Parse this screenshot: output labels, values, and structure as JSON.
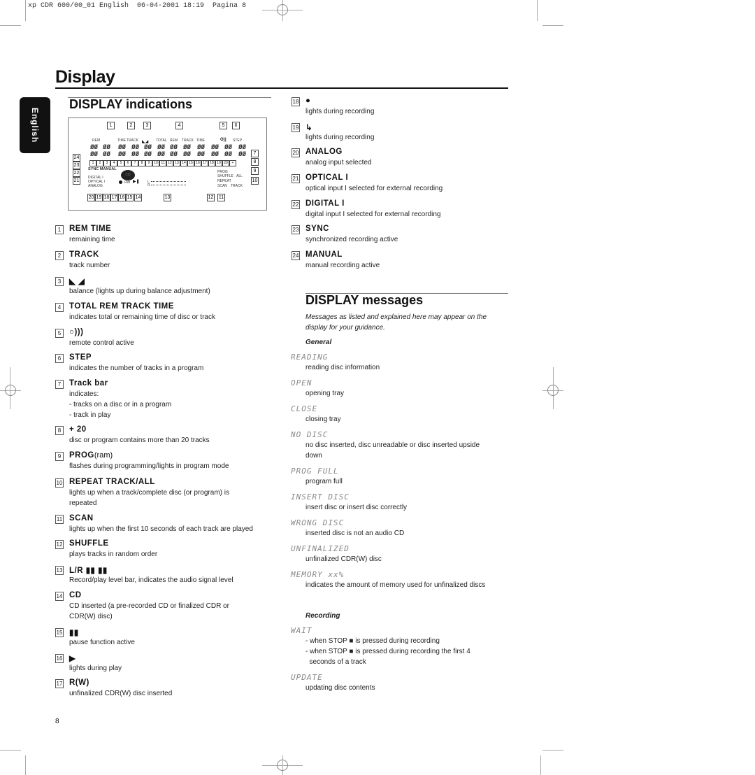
{
  "slug": "xp CDR 600/00_01 English  06-04-2001 18:19  Pagina 8",
  "page_title": "Display",
  "language_tab": "English",
  "indications": {
    "heading": "DISPLAY indications",
    "diagram": {
      "top_labels": [
        "REM",
        "TIME",
        "TRACK",
        "TOTAL",
        "REM",
        "TRACK",
        "TIME",
        "STEP"
      ],
      "left_labels": [
        "SYNC MANUAL",
        "DIGITAL I",
        "OPTICAL I",
        "ANALOG"
      ],
      "right_labels": [
        "PROG",
        "SHUFFLE",
        "ALL",
        "REPEAT",
        "SCAN",
        "TRACK"
      ],
      "level_labels": [
        "L",
        "R"
      ],
      "rw_label": "RW",
      "cd_label": "CD",
      "track_bar": [
        "1",
        "2",
        "3",
        "4",
        "5",
        "6",
        "7",
        "8",
        "9",
        "10",
        "11",
        "12",
        "13",
        "14",
        "15",
        "16",
        "17",
        "18",
        "19",
        "20",
        "+"
      ],
      "callouts_top": [
        "1",
        "2",
        "3",
        "4",
        "5",
        "6"
      ],
      "callouts_right": [
        "7",
        "8",
        "9",
        "10"
      ],
      "callouts_left": [
        "24",
        "23",
        "22",
        "21"
      ],
      "callouts_bottom": [
        "20",
        "19",
        "18",
        "17",
        "16",
        "15",
        "14",
        "13",
        "12",
        "11"
      ]
    },
    "items": [
      {
        "n": "1",
        "title": "REM TIME",
        "desc": [
          "remaining time"
        ]
      },
      {
        "n": "2",
        "title": "TRACK",
        "desc": [
          "track number"
        ]
      },
      {
        "n": "3",
        "title": "◣ ◢",
        "desc": [
          "balance (lights up during balance adjustment)"
        ]
      },
      {
        "n": "4",
        "title": "TOTAL REM TRACK TIME",
        "desc": [
          "indicates total or remaining time of disc or track"
        ]
      },
      {
        "n": "5",
        "title": "○)))",
        "desc": [
          "remote control active"
        ]
      },
      {
        "n": "6",
        "title": "STEP",
        "desc": [
          "indicates the number of tracks in a program"
        ]
      },
      {
        "n": "7",
        "title": "Track bar",
        "desc": [
          "indicates:",
          "- tracks on a disc or in a program",
          "- track in play"
        ]
      },
      {
        "n": "8",
        "title": "+ 20",
        "desc": [
          "disc or program contains more than 20 tracks"
        ]
      },
      {
        "n": "9",
        "title": "PROG",
        "title_suffix": "(ram)",
        "desc": [
          "flashes during programming/lights in program mode"
        ]
      },
      {
        "n": "10",
        "title": "REPEAT TRACK/ALL",
        "desc": [
          "lights up when a track/complete disc (or program) is",
          "repeated"
        ]
      },
      {
        "n": "11",
        "title": "SCAN",
        "desc": [
          "lights up when the first 10 seconds of each track are played"
        ]
      },
      {
        "n": "12",
        "title": "SHUFFLE",
        "desc": [
          "plays tracks in random order"
        ]
      },
      {
        "n": "13",
        "title": "L/R ▮▮ ▮▮",
        "desc": [
          "Record/play level bar, indicates the audio signal level"
        ]
      },
      {
        "n": "14",
        "title": "CD",
        "desc": [
          "CD inserted (a pre-recorded CD or finalized CDR or",
          "CDR(W) disc)"
        ]
      },
      {
        "n": "15",
        "title": "▮▮",
        "desc": [
          "pause function active"
        ]
      },
      {
        "n": "16",
        "title": "▶",
        "desc": [
          "lights during play"
        ]
      },
      {
        "n": "17",
        "title": "R(W)",
        "desc": [
          "unfinalized CDR(W) disc inserted"
        ]
      },
      {
        "n": "18",
        "title": "●",
        "desc": [
          "lights during recording"
        ]
      },
      {
        "n": "19",
        "title": "↳",
        "desc": [
          "lights during recording"
        ]
      },
      {
        "n": "20",
        "title": "ANALOG",
        "desc": [
          "analog input selected"
        ]
      },
      {
        "n": "21",
        "title": "OPTICAL I",
        "desc": [
          "optical input I selected for external recording"
        ]
      },
      {
        "n": "22",
        "title": "DIGITAL I",
        "desc": [
          "digital input I selected for external recording"
        ]
      },
      {
        "n": "23",
        "title": "SYNC",
        "desc": [
          "synchronized recording active"
        ]
      },
      {
        "n": "24",
        "title": "MANUAL",
        "desc": [
          "manual recording active"
        ]
      }
    ]
  },
  "messages": {
    "heading": "DISPLAY messages",
    "intro": [
      "Messages as listed and explained here may appear on the",
      "display for your guidance."
    ],
    "general_heading": "General",
    "general": [
      {
        "code": "READING",
        "desc": [
          "reading disc information"
        ]
      },
      {
        "code": "OPEN",
        "desc": [
          "opening tray"
        ]
      },
      {
        "code": "CLOSE",
        "desc": [
          "closing tray"
        ]
      },
      {
        "code": "NO DISC",
        "desc": [
          "no disc inserted, disc unreadable or disc inserted upside",
          "down"
        ]
      },
      {
        "code": "PROG FULL",
        "desc": [
          "program full"
        ]
      },
      {
        "code": "INSERT DISC",
        "desc": [
          "insert disc or insert disc correctly"
        ]
      },
      {
        "code": "WRONG DISC",
        "desc": [
          "inserted disc is not an audio CD"
        ]
      },
      {
        "code": "UNFINALIZED",
        "desc": [
          "unfinalized CDR(W) disc"
        ]
      },
      {
        "code": "MEMORY xx%",
        "desc": [
          "indicates the amount of memory used for unfinalized discs"
        ]
      }
    ],
    "recording_heading": "Recording",
    "recording": [
      {
        "code": "WAIT",
        "desc": [
          "- when STOP ■ is pressed during recording",
          "- when STOP ■ is pressed during recording the first 4",
          "  seconds of a track"
        ]
      },
      {
        "code": "UPDATE",
        "desc": [
          "updating disc contents"
        ]
      }
    ]
  },
  "page_number": "8"
}
